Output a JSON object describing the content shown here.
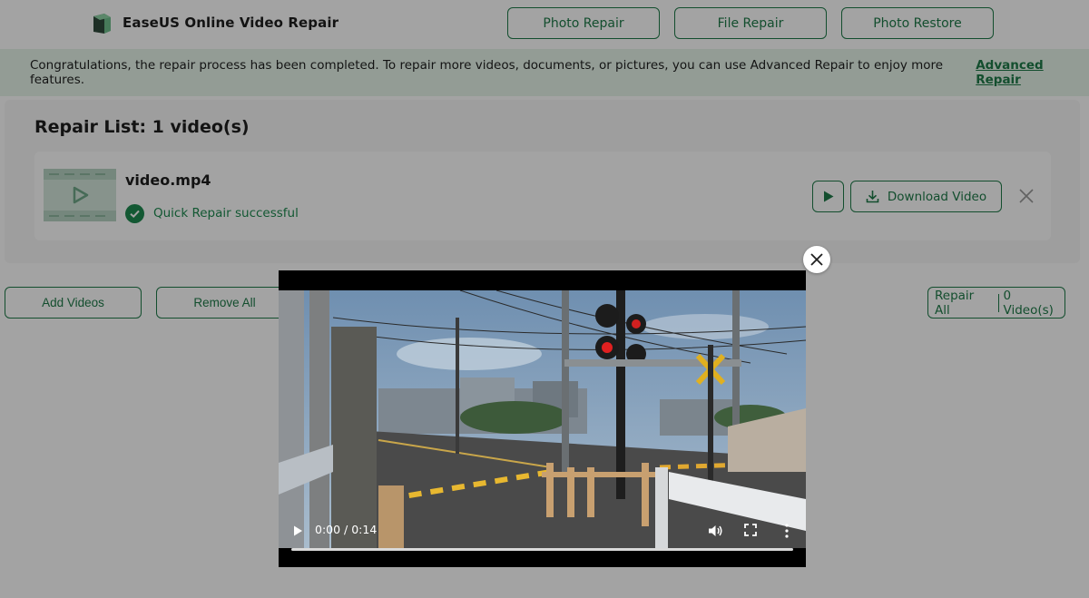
{
  "header": {
    "app_title": "EaseUS Online Video Repair",
    "nav": [
      "Photo Repair",
      "File Repair",
      "Photo Restore"
    ]
  },
  "banner": {
    "message": "Congratulations, the repair process has been completed. To repair more videos, documents, or pictures, you can use Advanced Repair to enjoy more features.",
    "link_label": "Advanced Repair"
  },
  "repair_list": {
    "title": "Repair List: 1 video(s)",
    "items": [
      {
        "file_name": "video.mp4",
        "status": "Quick Repair successful",
        "download_label": "Download Video"
      }
    ]
  },
  "actions": {
    "add_videos": "Add Videos",
    "remove_all": "Remove All",
    "repair_all": "Repair All",
    "video_count": "0 Video(s)"
  },
  "player": {
    "time": "0:00 / 0:14",
    "progress": 0
  },
  "colors": {
    "accent": "#1e7a48",
    "success": "#1e8a50",
    "banner_bg": "#e6f5ea"
  },
  "icons": {
    "logo": "easeus-logo-icon",
    "status": "check-circle-icon",
    "play": "play-icon",
    "download": "download-icon",
    "remove": "close-icon",
    "modal_close": "close-icon",
    "volume": "volume-icon",
    "fullscreen": "fullscreen-icon",
    "more": "more-vertical-icon"
  }
}
